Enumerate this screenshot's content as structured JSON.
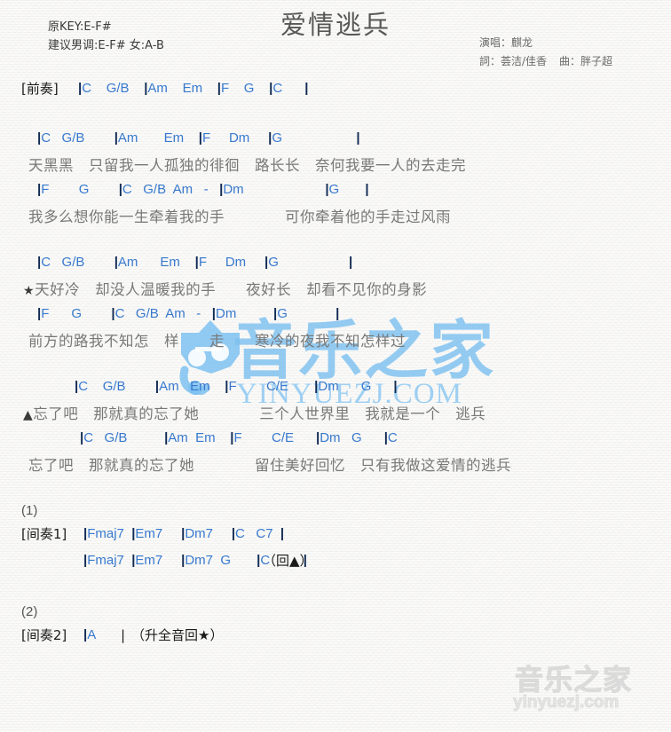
{
  "header": {
    "title": "爱情逃兵",
    "key_line_1": "原KEY:E-F#",
    "key_line_2": "建议男调:E-F# 女:A-B",
    "singer_line": "演唱：麒龙",
    "writer_line": "詞：荟洁/佳香",
    "composer_line": "曲：胖子超"
  },
  "colors": {
    "chord": "#3879ce",
    "barline": "#102a53",
    "lyric": "#787878",
    "label": "#1b1b1b",
    "background": "#f6f5f3",
    "watermark_blue": "#7ec1f0",
    "watermark_grey": "#d2d2d2"
  },
  "watermarks": {
    "center_cn": "音乐之家",
    "center_en": "YINYUEZJ.COM",
    "corner_cn": "音乐之家",
    "corner_en": "yinyuezj.com"
  },
  "sections": {
    "prelude": {
      "label": "[前奏]",
      "chords": "|C    G/B    |Am    Em    |F    G    |C      |"
    },
    "verse1": {
      "chord_1": "|C   G/B        |Am       Em    |F     Dm     |G                    |",
      "lyric_1": "天黑黑　只留我一人孤独的徘徊　路长长　奈何我要一人的去走完",
      "chord_2": "|F        G        |C   G/B  Am   -   |Dm                      |G       |",
      "lyric_2": "我多么想你能一生牵着我的手　　　　可你牵着他的手走过风雨"
    },
    "verse2": {
      "chord_1": "|C   G/B        |Am      Em    |F     Dm     |G                   |",
      "lyric_1": "★天好冷　却没人温暖我的手　　夜好长　却看不见你的身影",
      "chord_2": "|F      G        |C   G/B  Am   -   |Dm          |G             |",
      "lyric_2": "前方的路我不知怎　样　　走　　寒冷的夜我不知怎样过"
    },
    "chorus1": {
      "chord": "|C    G/B        |Am   Em    |F        C/E       |Dm      G      |",
      "lyric": "▲忘了吧　那就真的忘了她　　　　三个人世界里　我就是一个　逃兵"
    },
    "chorus2": {
      "chord": "|C   G/B          |Am  Em    |F        C/E      |Dm   G      |C",
      "lyric": "忘了吧　那就真的忘了她　　　　留住美好回忆　只有我做这爱情的逃兵"
    },
    "interlude1": {
      "number": "(1)",
      "label": "[间奏1]",
      "chord_line_1": "|Fmaj7  |Em7     |Dm7     |C   C7  |",
      "chord_line_2": "|Fmaj7  |Em7     |Dm7  G       |C         |",
      "repeat_note": "（回▲）"
    },
    "interlude2": {
      "number": "(2)",
      "label": "[间奏2]",
      "chord_line": "|A",
      "bar": "|",
      "repeat_note": "（升全音回★）"
    }
  }
}
